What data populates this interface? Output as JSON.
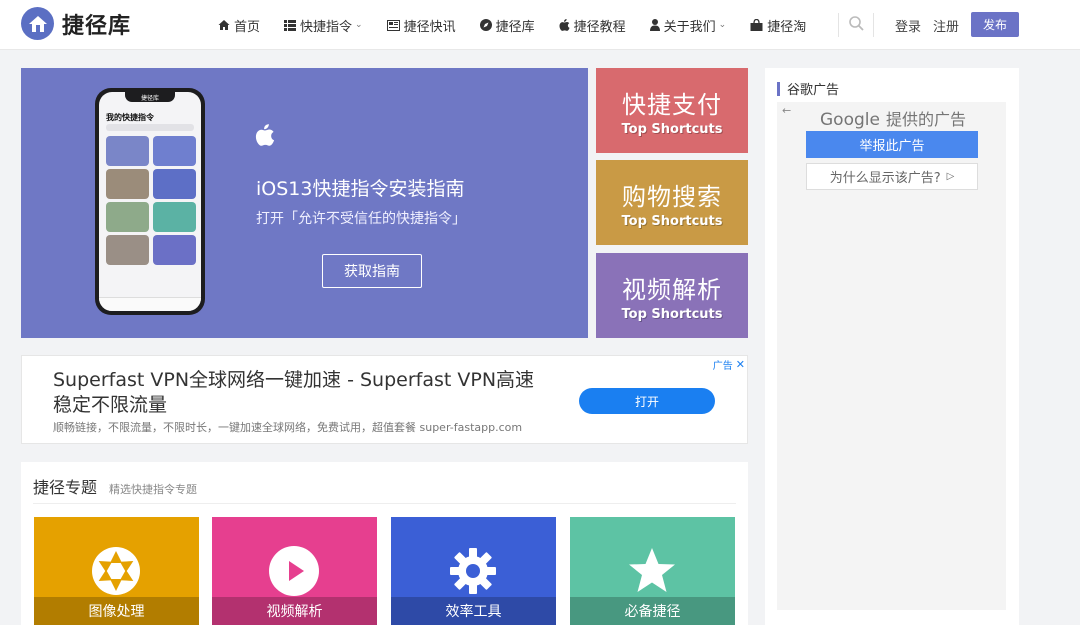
{
  "header": {
    "logo_text": "捷径库",
    "nav": [
      {
        "label": "首页",
        "icon": "home-icon",
        "has_dropdown": false
      },
      {
        "label": "快捷指令",
        "icon": "grid-list-icon",
        "has_dropdown": true
      },
      {
        "label": "捷径快讯",
        "icon": "newspaper-icon",
        "has_dropdown": false
      },
      {
        "label": "捷径库",
        "icon": "compass-icon",
        "has_dropdown": false
      },
      {
        "label": "捷径教程",
        "icon": "apple-icon",
        "has_dropdown": false
      },
      {
        "label": "关于我们",
        "icon": "user-icon",
        "has_dropdown": true
      },
      {
        "label": "捷径淘",
        "icon": "shopping-bag-icon",
        "has_dropdown": false
      }
    ],
    "login": "登录",
    "register": "注册",
    "publish": "发布"
  },
  "banner": {
    "title": "iOS13快捷指令安装指南",
    "subtitle": "打开「允许不受信任的快捷指令」",
    "button": "获取指南",
    "phone_app_name": "捷径库",
    "phone_heading": "我的快捷指令"
  },
  "promos": [
    {
      "title": "快捷支付",
      "sub": "Top Shortcuts",
      "color": "#d86a6e"
    },
    {
      "title": "购物搜索",
      "sub": "Top Shortcuts",
      "color": "#c99a45"
    },
    {
      "title": "视频解析",
      "sub": "Top Shortcuts",
      "color": "#8a72b8"
    }
  ],
  "ad": {
    "title": "Superfast VPN全球网络一键加速 - Superfast VPN高速稳定不限流量",
    "desc": "顺畅链接，不限流量，不限时长，一键加速全球网络，免费试用，超值套餐 super-fastapp.com",
    "button": "打开",
    "mark": "广告"
  },
  "topics": {
    "title": "捷径专题",
    "subtitle": "精选快捷指令专题",
    "items": [
      {
        "label": "图像处理",
        "icon": "aperture-icon",
        "color": "#e5a100"
      },
      {
        "label": "视频解析",
        "icon": "play-circle-icon",
        "color": "#e63f8f"
      },
      {
        "label": "效率工具",
        "icon": "cog-icon",
        "color": "#3b5fd6"
      },
      {
        "label": "必备捷径",
        "icon": "star-icon",
        "color": "#5dc3a4"
      }
    ]
  },
  "sidebar": {
    "title": "谷歌广告",
    "google_word": "Google",
    "google_sub": "提供的广告",
    "report": "举报此广告",
    "why": "为什么显示该广告?"
  }
}
